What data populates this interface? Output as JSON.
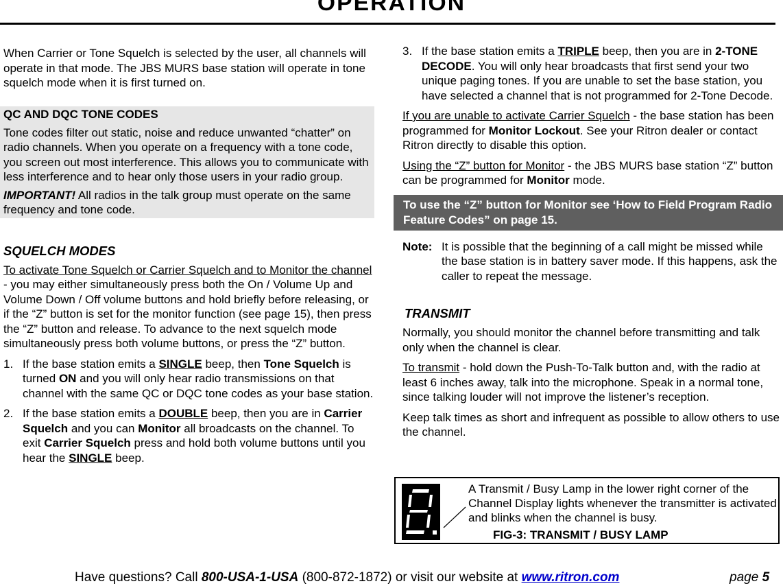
{
  "page": {
    "title": "OPERATION",
    "page_label": "page",
    "page_number": "5"
  },
  "left": {
    "intro": "When Carrier or Tone Squelch is selected by the user, all channels will operate in that mode. The JBS MURS base station will operate in tone squelch mode when it is first turned on.",
    "tone_codes": {
      "heading": "QC AND DQC TONE CODES",
      "body": "Tone codes filter out static, noise and reduce unwanted “chatter” on radio channels. When you operate on a frequency with a tone code, you screen out most interference. This allows you to communicate with less interference and to hear only those users in your radio group.",
      "important_label": "IMPORTANT!",
      "important_text": " All radios in the talk group must operate on the same frequency and tone code."
    },
    "squelch": {
      "heading": "SQUELCH MODES",
      "lead_underlined": "To activate Tone Squelch or Carrier Squelch and to Monitor the channel",
      "lead_text": " - you may either simultaneously press both the On / Volume Up and Volume Down / Off volume buttons and hold briefly before releasing, or if the “Z” button is set for the monitor function (see page 15), then press the “Z” button and release. To advance to the next squelch mode simultaneously press both volume buttons, or press the “Z” button.",
      "items": [
        {
          "num": "1.",
          "t1": "If the base station emits a ",
          "beep": "SINGLE",
          "t2": " beep, then ",
          "b1": "Tone Squelch",
          "t3": " is turned ",
          "b2": "ON",
          "t4": " and you will only hear radio transmissions on that channel with the same QC or DQC tone codes as your base station."
        },
        {
          "num": "2.",
          "t1": "If the base station emits a ",
          "beep": "DOUBLE",
          "t2": " beep, then you are in ",
          "b1": "Carrier Squelch",
          "t3": " and you can ",
          "b2": "Monitor",
          "t4": " all broadcasts on the channel. To exit ",
          "b3": "Carrier Squelch",
          "t5": " press and hold both volume buttons until you hear the ",
          "beep2": "SINGLE",
          "t6": " beep."
        }
      ]
    }
  },
  "right": {
    "item3": {
      "num": "3.",
      "t1": "If the base station emits a ",
      "beep": "TRIPLE",
      "t2": " beep, then you are in ",
      "b1": "2-TONE DECODE",
      "t3": ". You will only hear broadcasts that first send your two unique paging tones. If you are unable to set the base station, you have selected a channel that is not programmed for 2-Tone Decode."
    },
    "carrier_fail": {
      "underlined": "If you are unable to activate Carrier Squelch",
      "t1": " - the base station has been programmed for ",
      "bold": "Monitor Lockout",
      "t2": ". See your Ritron dealer or contact Ritron directly to disable this option."
    },
    "z_button": {
      "underlined": "Using the “Z” button for Monitor",
      "t1": " - the JBS MURS base station “Z” button can be programmed for ",
      "bold": "Monitor",
      "t2": " mode."
    },
    "callout": "To use the “Z” button for Monitor see ‘How to Field Program Radio Feature Codes” on page 15.",
    "note": {
      "label": "Note:",
      "text": "It is possible that the beginning of a call might be missed while the base station is in battery saver mode. If this happens, ask the caller to repeat the message."
    },
    "transmit": {
      "heading": "TRANSMIT",
      "p1": "Normally, you should monitor the channel before transmitting and talk only when the channel is clear.",
      "p2_underlined": "To transmit",
      "p2_text": " - hold down the Push-To-Talk button and, with the radio at least 6 inches away, talk into the microphone. Speak in a normal tone, since talking louder will not improve the listener’s reception.",
      "p3": "Keep talk times as short and infrequent as possible to allow others to use the channel."
    }
  },
  "figure": {
    "icon": "seven-segment-display-icon",
    "text": "A Transmit / Busy Lamp in the lower right corner of the Channel Display lights whenever the transmitter is activated and blinks when the channel is busy.",
    "caption": "FIG-3: TRANSMIT / BUSY LAMP"
  },
  "footer": {
    "t1": "Have questions?  Call ",
    "phone_word": "800-USA-1-USA",
    "t2": " (800-872-1872) or visit our website at ",
    "website": "www.ritron.com"
  },
  "colors": {
    "gray_box": "#e6e6e6",
    "dark_box": "#5f5f5f",
    "link": "#0000cc"
  }
}
